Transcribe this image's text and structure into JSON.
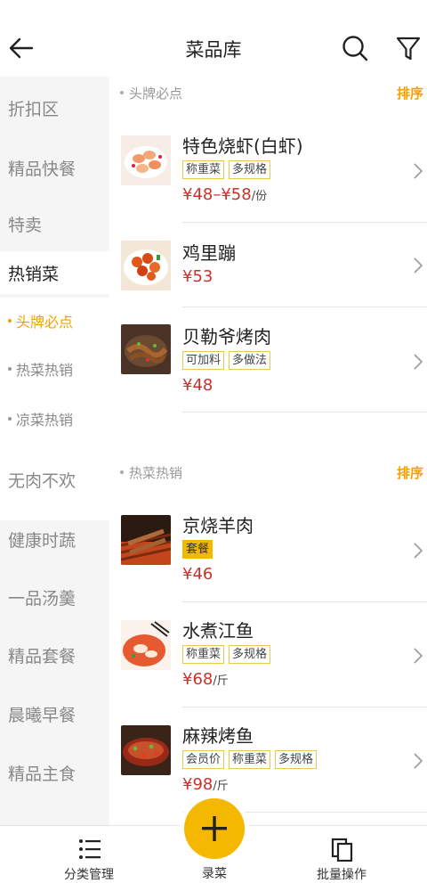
{
  "header": {
    "title": "菜品库",
    "back_icon": "arrow-left-icon",
    "search_icon": "search-icon",
    "filter_icon": "filter-icon"
  },
  "sidebar": {
    "items": [
      {
        "label": "折扣区"
      },
      {
        "label": "精品快餐"
      },
      {
        "label": "特卖"
      },
      {
        "label": "热销菜"
      },
      {
        "label": "无肉不欢"
      },
      {
        "label": "健康时蔬"
      },
      {
        "label": "一品汤羹"
      },
      {
        "label": "精品套餐"
      },
      {
        "label": "晨曦早餐"
      },
      {
        "label": "精品主食"
      }
    ],
    "subitems": [
      {
        "label": "头牌必点"
      },
      {
        "label": "热菜热销"
      },
      {
        "label": "凉菜热销"
      }
    ]
  },
  "sections": [
    {
      "name": "头牌必点",
      "sort_label": "排序",
      "dishes": [
        {
          "name": "特色烧虾(白虾)",
          "tags": [
            "称重菜",
            "多规格"
          ],
          "price": "¥48–¥58",
          "unit": "/份"
        },
        {
          "name": "鸡里蹦",
          "tags": [],
          "price": "¥53",
          "unit": ""
        },
        {
          "name": "贝勒爷烤肉",
          "tags": [
            "可加料",
            "多做法"
          ],
          "price": "¥48",
          "unit": ""
        }
      ]
    },
    {
      "name": "热菜热销",
      "sort_label": "排序",
      "dishes": [
        {
          "name": "京烧羊肉",
          "tags": [
            "套餐"
          ],
          "price": "¥46",
          "unit": ""
        },
        {
          "name": "水煮江鱼",
          "tags": [
            "称重菜",
            "多规格"
          ],
          "price": "¥68",
          "unit": "/斤"
        },
        {
          "name": "麻辣烤鱼",
          "tags": [
            "会员价",
            "称重菜",
            "多规格"
          ],
          "price": "¥98",
          "unit": "/斤"
        }
      ]
    }
  ],
  "bottom": {
    "left_label": "分类管理",
    "center_label": "录菜",
    "right_label": "批量操作"
  },
  "colors": {
    "accent": "#f5a000",
    "price": "#c8322c",
    "fab": "#f5b800"
  }
}
